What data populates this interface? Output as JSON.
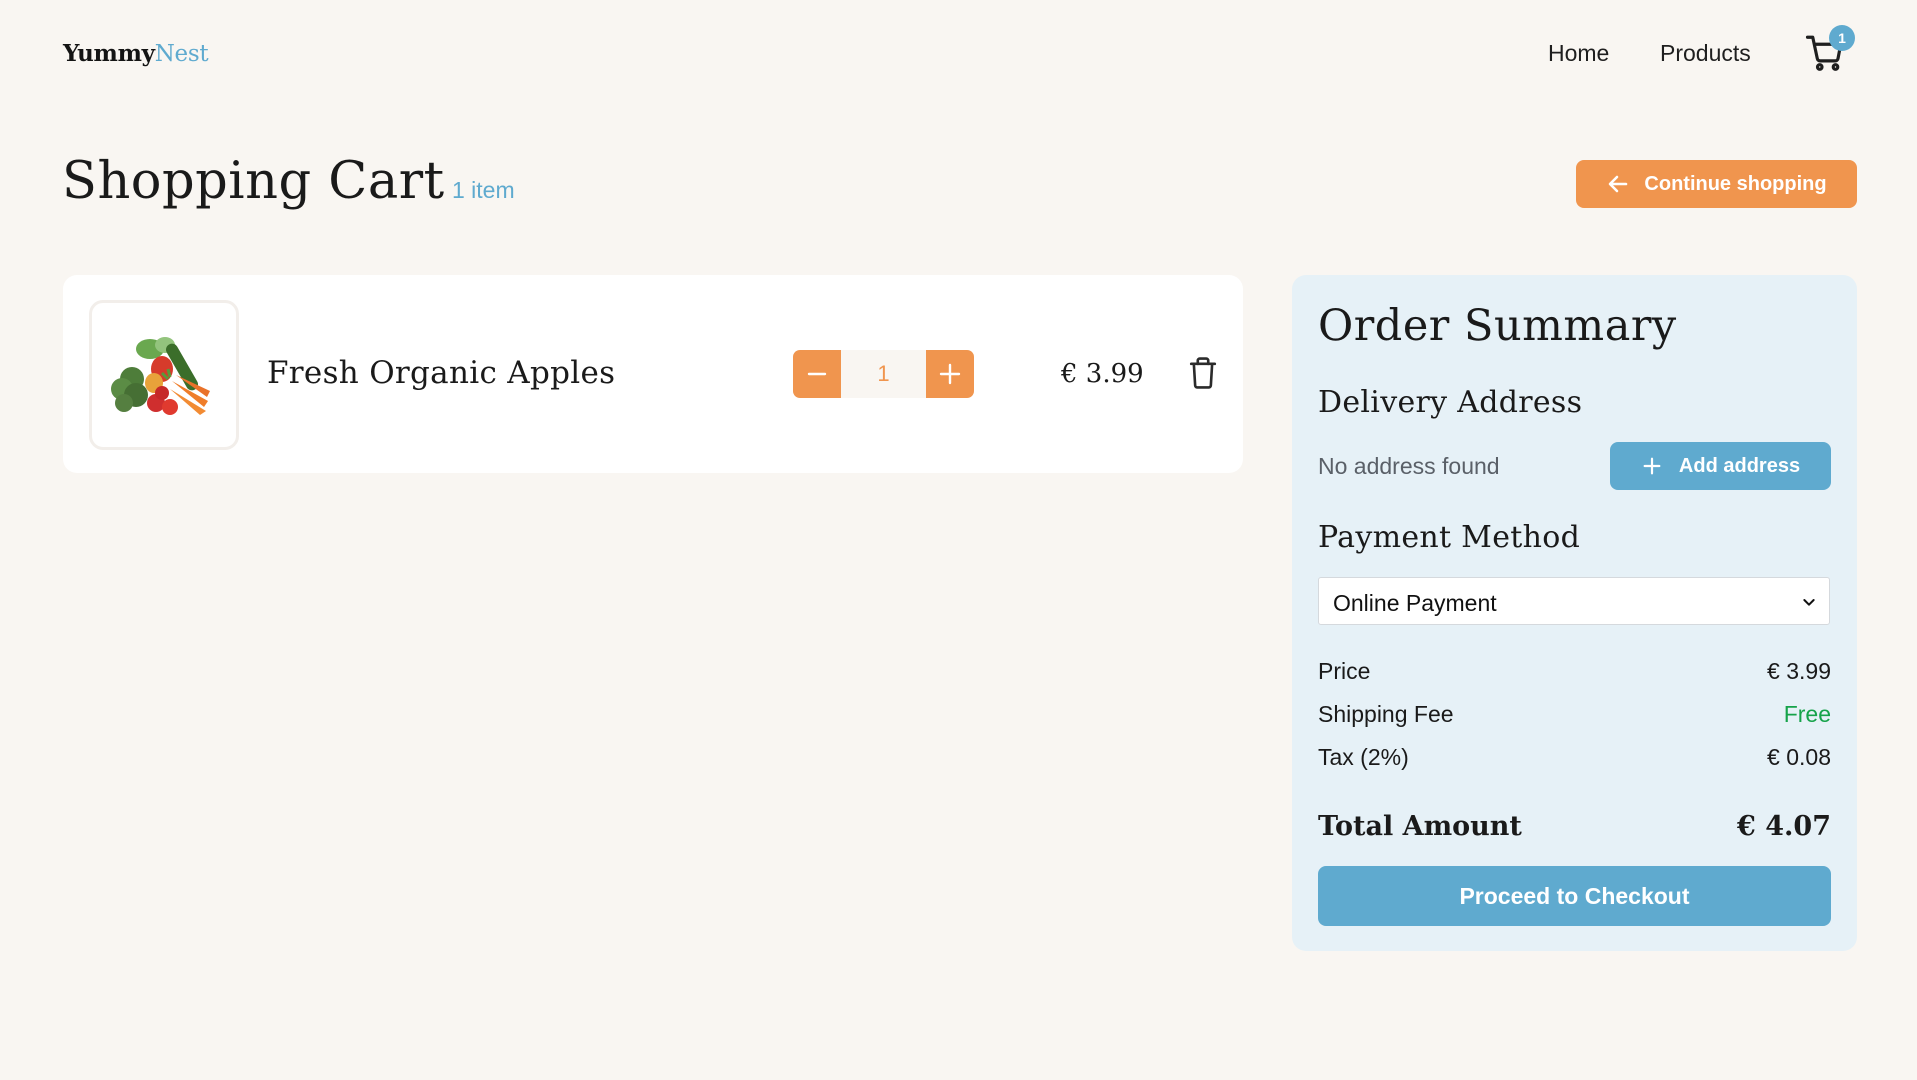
{
  "brand": {
    "name_part1": "Yummy",
    "name_part2": "Nest",
    "accent": "#5faacf",
    "orange": "#f0954e"
  },
  "nav": {
    "home": "Home",
    "products": "Products",
    "cart_count": "1",
    "cart_icon": "shopping-cart-icon"
  },
  "page": {
    "title": "Shopping Cart",
    "item_count": "1 item",
    "continue_label": "Continue shopping"
  },
  "cart": {
    "items": [
      {
        "name": "Fresh Organic Apples",
        "quantity": "1",
        "price": "€ 3.99",
        "image_icon": "vegetables-image"
      }
    ]
  },
  "summary": {
    "title": "Order Summary",
    "delivery_title": "Delivery Address",
    "no_address": "No address found",
    "add_address": "Add address",
    "payment_title": "Payment Method",
    "payment_selected": "Online Payment",
    "price_label": "Price",
    "price_value": "€ 3.99",
    "shipping_label": "Shipping Fee",
    "shipping_value": "Free",
    "tax_label": "Tax (2%)",
    "tax_value": "€ 0.08",
    "total_label": "Total Amount",
    "total_value": "€ 4.07",
    "checkout_label": "Proceed to Checkout"
  }
}
